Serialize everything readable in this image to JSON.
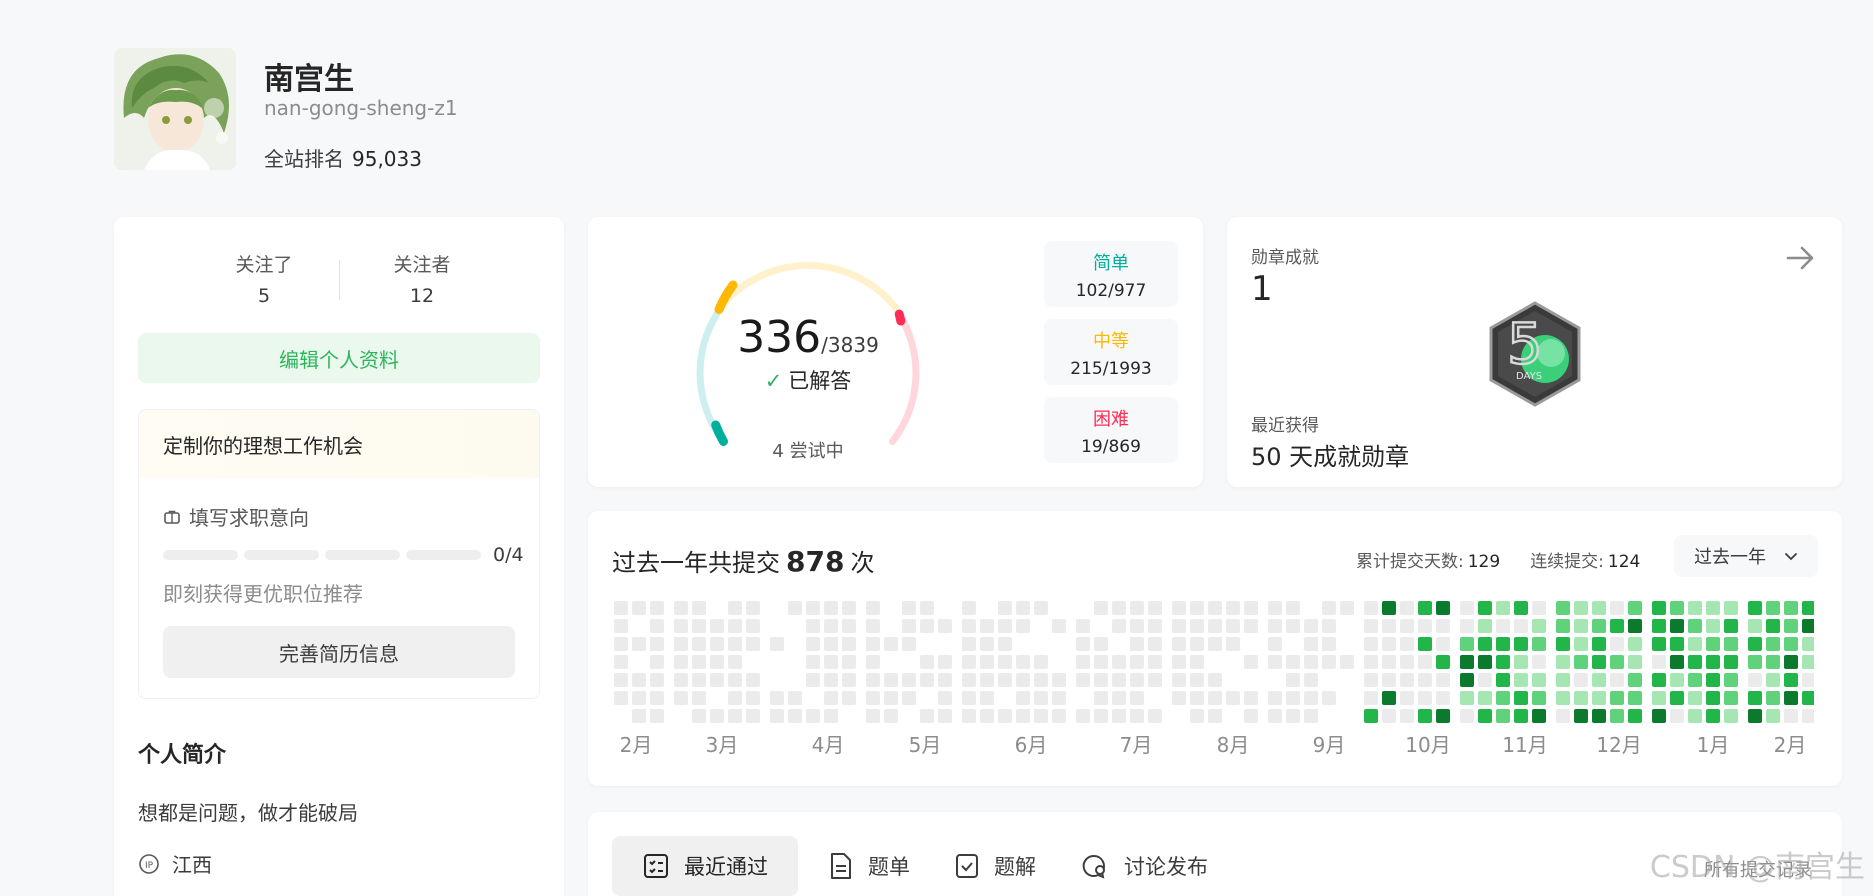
{
  "profile": {
    "name": "南宫生",
    "username": "nan-gong-sheng-z1",
    "rank_label": "全站排名",
    "rank_value": "95,033"
  },
  "follow": {
    "following_label": "关注了",
    "following_count": "5",
    "followers_label": "关注者",
    "followers_count": "12"
  },
  "edit_profile_label": "编辑个人资料",
  "job": {
    "title": "定制你的理想工作机会",
    "subtitle": "填写求职意向",
    "progress": "0/4",
    "progress_value": 0,
    "hint": "即刻获得更优职位推荐",
    "button": "完善简历信息"
  },
  "bio": {
    "title": "个人简介",
    "text": "想都是问题，做才能破局",
    "location": "江西"
  },
  "progress": {
    "solved": "336",
    "total": "/3839",
    "status": "已解答",
    "attempting": "4 尝试中",
    "difficulties": [
      {
        "name": "简单",
        "count": "102/977",
        "color": "#00af9b"
      },
      {
        "name": "中等",
        "count": "215/1993",
        "color": "#ffb800"
      },
      {
        "name": "困难",
        "count": "19/869",
        "color": "#ff2d55"
      }
    ]
  },
  "badge": {
    "label": "勋章成就",
    "count": "1",
    "recent_label": "最近获得",
    "recent_name": "50 天成就勋章",
    "medal_text": "DAYS",
    "medal_number": "5"
  },
  "heatmap": {
    "title_prefix": "过去一年共提交",
    "total": "878",
    "title_suffix": "次",
    "days_label": "累计提交天数:",
    "days_value": "129",
    "streak_label": "连续提交:",
    "streak_value": "124",
    "range": "过去一年",
    "months": [
      "2月",
      "3月",
      "4月",
      "5月",
      "6月",
      "7月",
      "8月",
      "9月",
      "10月",
      "11月",
      "12月",
      "1月",
      "2月"
    ],
    "colors": [
      "#ebebeb",
      "#a6e6b3",
      "#5fd27b",
      "#22b64a",
      "#0c7a2d"
    ]
  },
  "tabs": {
    "items": [
      "最近通过",
      "题单",
      "题解",
      "讨论发布"
    ],
    "all_link": "所有提交记录"
  },
  "watermark": "CSDN @南宫生"
}
